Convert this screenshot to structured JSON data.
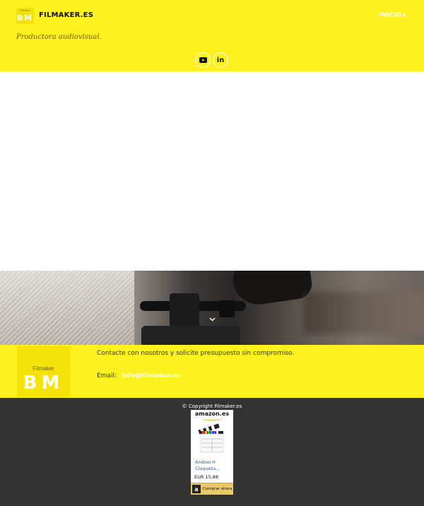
{
  "header": {
    "logo_top_text": "Filmaker",
    "logo_letters": "BM",
    "site_title": "FILMAKER.ES",
    "tagline": "Productora audiovisual.",
    "nav": {
      "inicio_label": "INICIO"
    },
    "social": [
      {
        "name": "youtube-icon"
      },
      {
        "name": "linkedin-icon",
        "glyph": "in"
      }
    ],
    "colors": {
      "brand_yellow": "#fdf01f",
      "white": "#ffffff"
    }
  },
  "contact": {
    "logo_name": "Filmaker",
    "logo_letters": "BM",
    "text": "Contacte con nosotros y solicite presupuesto sin compromiso.",
    "email_label": "Email:",
    "email_value": "info@filmaker.es"
  },
  "footer": {
    "copyright": "© Copyright  Filmaker.es",
    "background": "#333333"
  },
  "amazon_widget": {
    "logo": "amazon.es",
    "product_title_line1": "Andoer®",
    "product_title_line2": "Claqueta...",
    "price": "EUR 15,88",
    "buy_icon": "a",
    "buy_label": "Comprar ahora"
  }
}
